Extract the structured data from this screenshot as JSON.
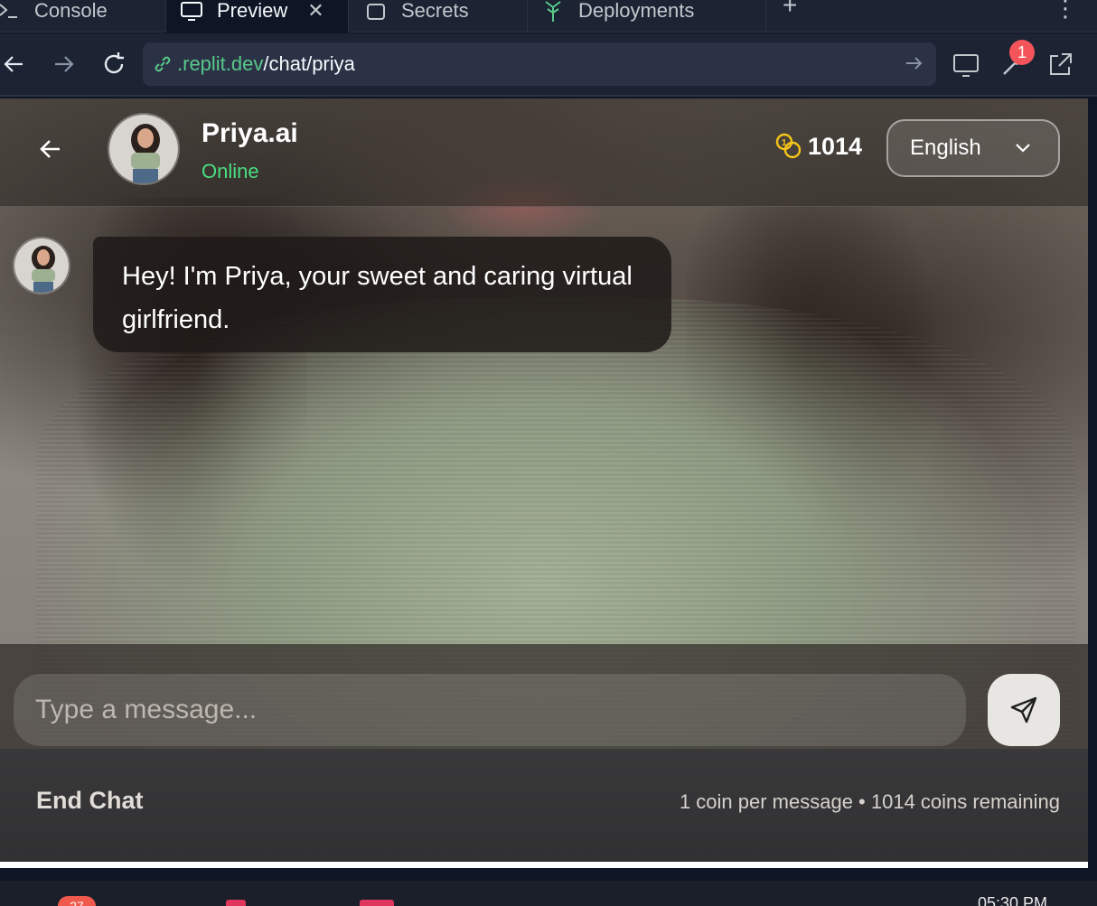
{
  "tabs": [
    {
      "label": "Console",
      "icon": "terminal-icon"
    },
    {
      "label": "Preview",
      "icon": "monitor-icon",
      "active": true
    },
    {
      "label": "Secrets",
      "icon": "lock-icon"
    },
    {
      "label": "Deployments",
      "icon": "deploy-icon"
    }
  ],
  "address": {
    "host": ".replit.dev",
    "path": "/chat/priya"
  },
  "toolbar": {
    "notification_count": "1"
  },
  "chat": {
    "name": "Priya.ai",
    "status": "Online",
    "coins": "1014",
    "language": "English",
    "messages": [
      {
        "sender": "bot",
        "text": "Hey! I'm Priya, your sweet and caring virtual girlfriend."
      }
    ],
    "input_placeholder": "Type a message...",
    "end_chat_label": "End Chat",
    "info": "1 coin per message • 1014 coins remaining"
  },
  "taskbar": {
    "badge": "27",
    "clock": "05:30 PM"
  },
  "colors": {
    "url_host": "#58c98b",
    "status_online": "#4ade80",
    "badge": "#f4555a",
    "coin": "#f5c518"
  }
}
